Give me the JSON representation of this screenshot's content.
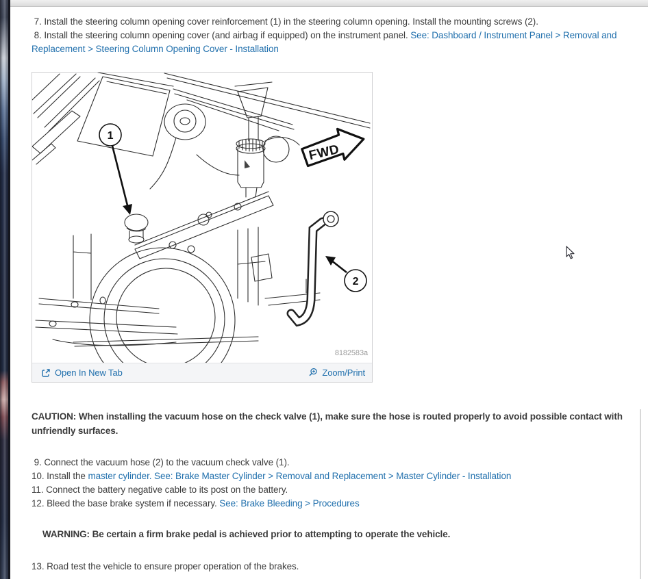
{
  "steps_top": [
    {
      "text": " 7. Install the steering column opening cover reinforcement (1) in the steering column opening. Install the mounting screws (2)."
    },
    {
      "text": " 8. Install the steering column opening cover (and airbag if equipped) on the instrument panel. ",
      "link": "See: Dashboard / Instrument Panel > Removal and Replacement > Steering Column Opening Cover - Installation"
    }
  ],
  "figure": {
    "footer": {
      "open_label": "Open In New Tab",
      "zoom_label": "Zoom/Print"
    },
    "diagram": {
      "callout_1": "1",
      "callout_2": "2",
      "fwd_label": "FWD",
      "figure_number": "8182583a"
    }
  },
  "caution": "CAUTION: When installing the vacuum hose on the check valve (1), make sure the hose is routed properly to avoid possible contact with unfriendly surfaces.",
  "steps_bottom": [
    {
      "text": " 9. Connect the vacuum hose (2) to the vacuum check valve (1)."
    },
    {
      "prefix": "10. Install the ",
      "link": "master cylinder. See: Brake Master Cylinder > Removal and Replacement > Master Cylinder - Installation"
    },
    {
      "text": "11. Connect the battery negative cable to its post on the battery."
    },
    {
      "prefix": "12. Bleed the base brake system if necessary. ",
      "link": "See: Brake Bleeding > Procedures"
    }
  ],
  "warning": "WARNING: Be certain a firm brake pedal is achieved prior to attempting to operate the vehicle.",
  "step_13": {
    "text": "13. Road test the vehicle to ensure proper operation of the brakes."
  },
  "colors": {
    "link_blue": "#2170ad",
    "body_text": "#3d3d3d",
    "footer_bg": "#f4f5f7",
    "strip_navy": "#232b41"
  }
}
